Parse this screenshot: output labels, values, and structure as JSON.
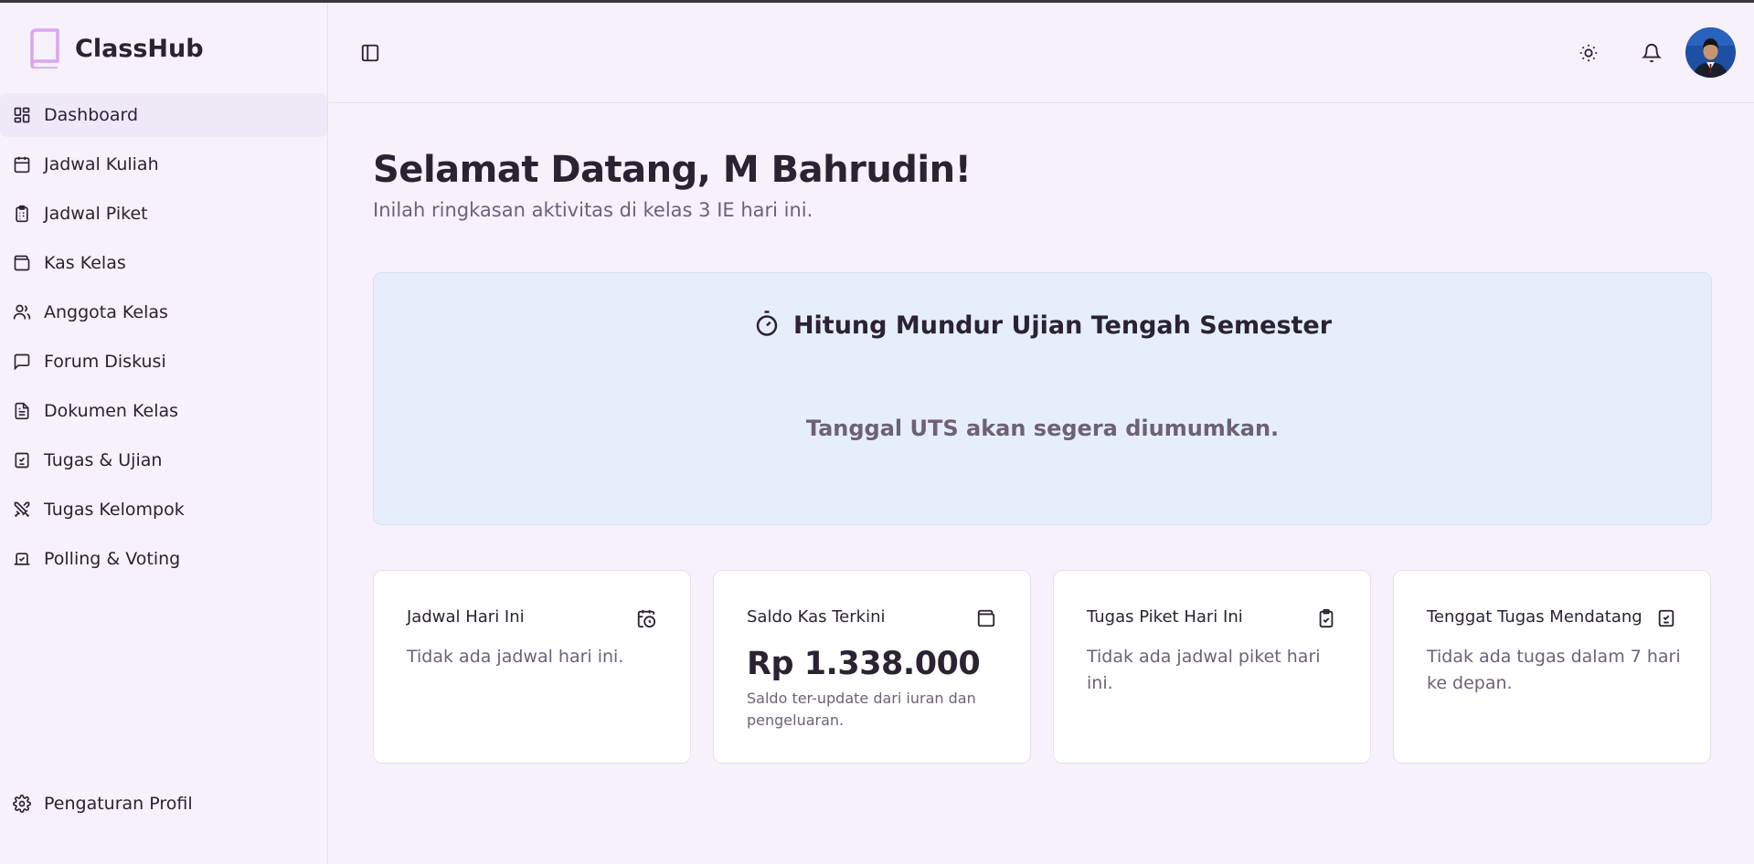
{
  "colors": {
    "background": "#f6f1fb",
    "accent": "#d9a7f0",
    "countdown_bg": "#e6eefb",
    "text": "#2b2233",
    "muted": "#6e6079"
  },
  "brand": {
    "name": "ClassHub",
    "logo_icon": "book-icon"
  },
  "sidebar": {
    "items": [
      {
        "label": "Dashboard",
        "icon": "dashboard-icon",
        "active": true
      },
      {
        "label": "Jadwal Kuliah",
        "icon": "calendar-icon"
      },
      {
        "label": "Jadwal Piket",
        "icon": "clipboard-list-icon"
      },
      {
        "label": "Kas Kelas",
        "icon": "wallet-icon"
      },
      {
        "label": "Anggota Kelas",
        "icon": "users-icon"
      },
      {
        "label": "Forum Diskusi",
        "icon": "chat-icon"
      },
      {
        "label": "Dokumen Kelas",
        "icon": "document-icon"
      },
      {
        "label": "Tugas & Ujian",
        "icon": "checklist-icon"
      },
      {
        "label": "Tugas Kelompok",
        "icon": "swords-icon"
      },
      {
        "label": "Polling & Voting",
        "icon": "vote-icon"
      }
    ],
    "bottom": {
      "label": "Pengaturan Profil",
      "icon": "gear-icon"
    }
  },
  "header": {
    "toggle_icon": "sidebar-toggle-icon",
    "theme_icon": "sun-icon",
    "notification_icon": "bell-icon"
  },
  "main": {
    "title": "Selamat Datang, M Bahrudin!",
    "subtitle": "Inilah ringkasan aktivitas di kelas 3 IE hari ini."
  },
  "countdown": {
    "icon": "timer-icon",
    "title": "Hitung Mundur Ujian Tengah Semester",
    "message": "Tanggal UTS akan segera diumumkan."
  },
  "cards": [
    {
      "title": "Jadwal Hari Ini",
      "icon": "calendar-clock-icon",
      "text": "Tidak ada jadwal hari ini."
    },
    {
      "title": "Saldo Kas Terkini",
      "icon": "wallet-icon",
      "amount": "Rp 1.338.000",
      "note": "Saldo ter-update dari iuran dan pengeluaran."
    },
    {
      "title": "Tugas Piket Hari Ini",
      "icon": "clipboard-check-icon",
      "text": "Tidak ada jadwal piket hari ini."
    },
    {
      "title": "Tenggat Tugas Mendatang",
      "icon": "checklist-icon",
      "text": "Tidak ada tugas dalam 7 hari ke depan."
    }
  ]
}
